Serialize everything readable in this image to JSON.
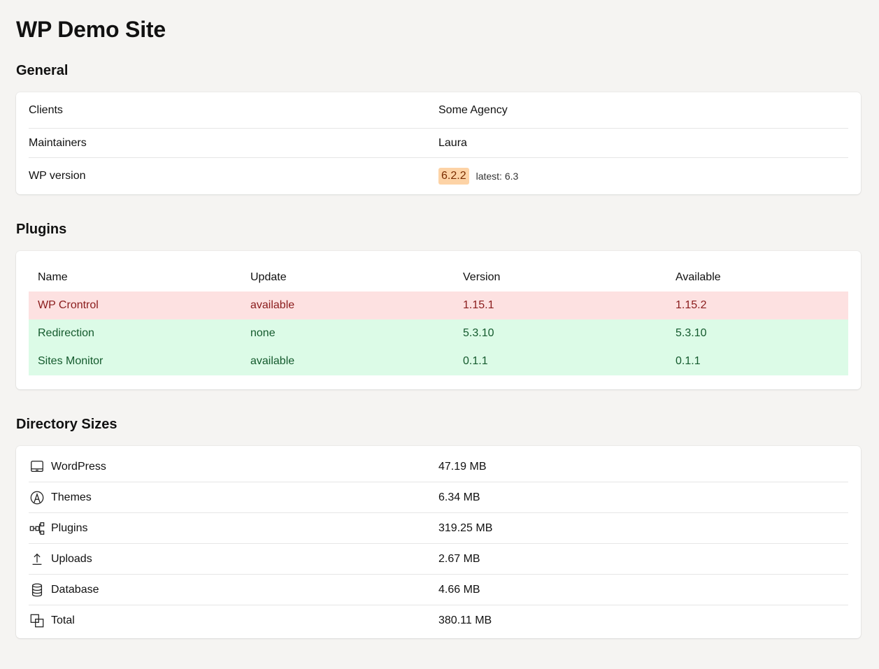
{
  "site_title": "WP Demo Site",
  "general": {
    "heading": "General",
    "rows": [
      {
        "label": "Clients",
        "value": "Some Agency"
      },
      {
        "label": "Maintainers",
        "value": "Laura"
      },
      {
        "label": "WP version",
        "value": "6.2.2",
        "latest": "latest: 6.3"
      }
    ]
  },
  "plugins": {
    "heading": "Plugins",
    "columns": [
      "Name",
      "Update",
      "Version",
      "Available"
    ],
    "rows": [
      {
        "name": "WP Crontrol",
        "update": "available",
        "version": "1.15.1",
        "available": "1.15.2",
        "status": "red"
      },
      {
        "name": "Redirection",
        "update": "none",
        "version": "5.3.10",
        "available": "5.3.10",
        "status": "green"
      },
      {
        "name": "Sites Monitor",
        "update": "available",
        "version": "0.1.1",
        "available": "0.1.1",
        "status": "green"
      }
    ]
  },
  "directory_sizes": {
    "heading": "Directory Sizes",
    "rows": [
      {
        "icon": "laptop-icon",
        "label": "WordPress",
        "value": "47.19 MB"
      },
      {
        "icon": "palette-icon",
        "label": "Themes",
        "value": "6.34 MB"
      },
      {
        "icon": "plugin-tree-icon",
        "label": "Plugins",
        "value": "319.25 MB"
      },
      {
        "icon": "upload-icon",
        "label": "Uploads",
        "value": "2.67 MB"
      },
      {
        "icon": "database-icon",
        "label": "Database",
        "value": "4.66 MB"
      },
      {
        "icon": "stack-icon",
        "label": "Total",
        "value": "380.11 MB"
      }
    ]
  },
  "colors": {
    "background": "#f5f4f2",
    "badge_bg": "#fdd3a6",
    "row_red": "#fde1e1",
    "row_green": "#dcfbe7"
  }
}
